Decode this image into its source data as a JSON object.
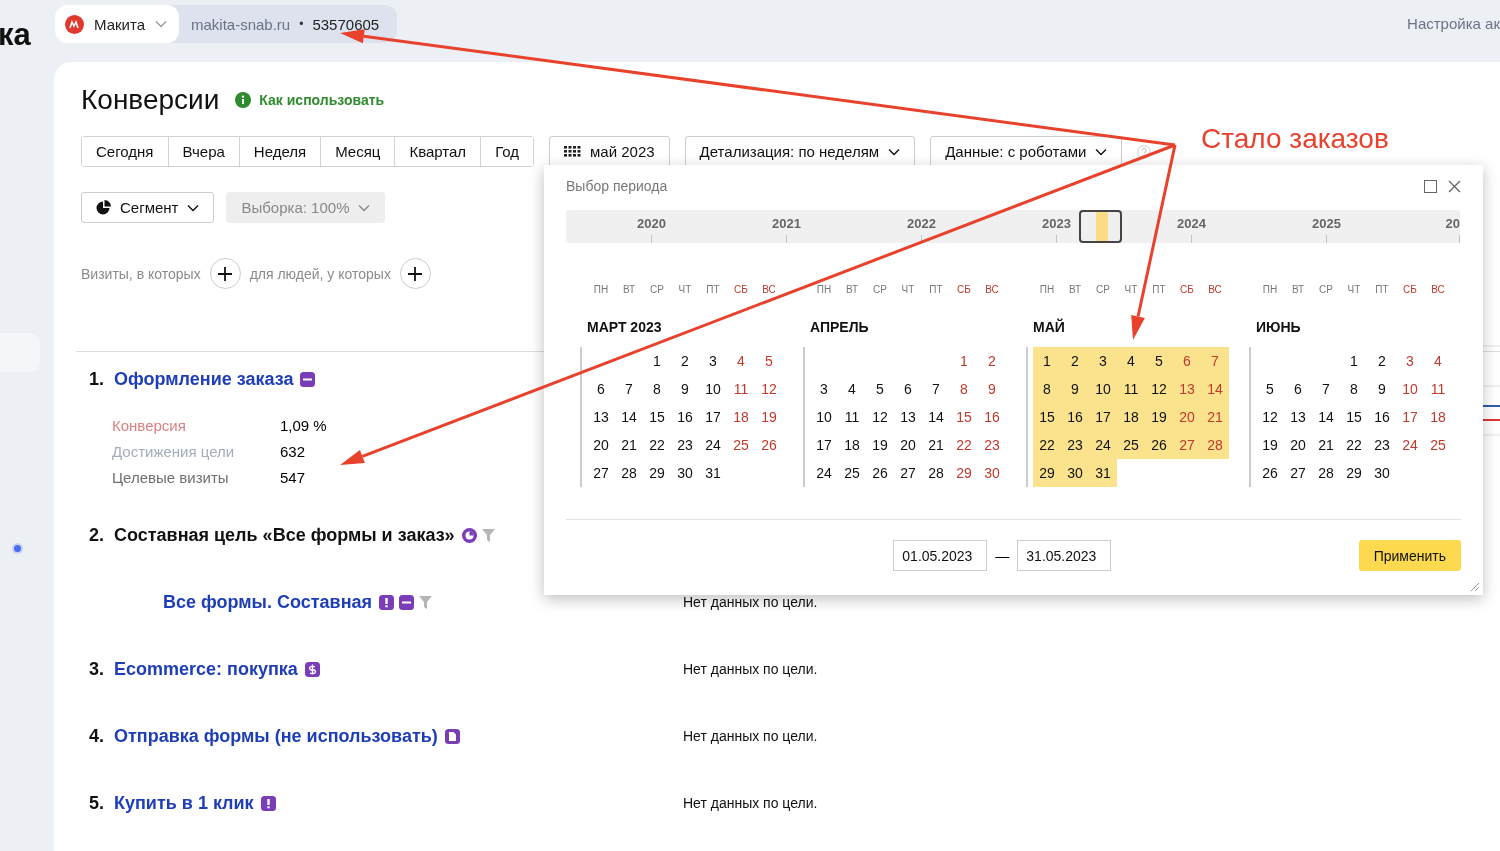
{
  "page_title_fragment": "ка",
  "account": {
    "name": "Макита",
    "site": "makita-snab.ru",
    "separator": "•",
    "counter": "53570605"
  },
  "top_right_link": "Настройка ак",
  "report": {
    "title": "Конверсии",
    "help_link": "Как использовать",
    "periods": [
      "Сегодня",
      "Вчера",
      "Неделя",
      "Месяц",
      "Квартал",
      "Год"
    ],
    "date_button": "май 2023",
    "detail_dropdown": "Детализация: по неделям",
    "data_dropdown": "Данные: с роботами",
    "segment_button": "Сегмент",
    "sample_dropdown": {
      "label": "Выборка: 100%",
      "disabled": true
    },
    "filter": {
      "visits_label": "Визиты, в которых",
      "people_label": "для людей, у которых"
    },
    "goals": [
      {
        "number": "1.",
        "name": "Оформление заказа",
        "kind": "link",
        "badges": [
          {
            "kind": "url"
          }
        ],
        "metrics": [
          {
            "label": "Конверсия",
            "value": "1,09 %",
            "color": "#d98080"
          },
          {
            "label": "Достижения цели",
            "value": "632",
            "color": "#a3acbd"
          },
          {
            "label": "Целевые визиты",
            "value": "547",
            "color": "#6f6f6f"
          }
        ]
      },
      {
        "number": "2.",
        "name": "Составная цель «Все формы и заказ»",
        "kind": "composite",
        "badges": [
          {
            "kind": "pie"
          },
          {
            "kind": "funnel"
          }
        ],
        "children": [
          {
            "name": "Все формы. Составная",
            "badges": [
              {
                "kind": "exclaim"
              },
              {
                "kind": "url"
              },
              {
                "kind": "funnel"
              }
            ],
            "note": "Нет данных по цели."
          }
        ]
      },
      {
        "number": "3.",
        "name": "Ecommerce: покупка",
        "kind": "link",
        "badges": [
          {
            "kind": "dollar"
          }
        ],
        "note": "Нет данных по цели."
      },
      {
        "number": "4.",
        "name": "Отправка формы (не использовать)",
        "kind": "link",
        "badges": [
          {
            "kind": "doc"
          }
        ],
        "note": "Нет данных по цели."
      },
      {
        "number": "5.",
        "name": "Купить в 1 клик",
        "kind": "link",
        "badges": [
          {
            "kind": "exclaim"
          }
        ],
        "note": "Нет данных по цели."
      }
    ]
  },
  "picker": {
    "title": "Выбор периода",
    "years": [
      "2020",
      "2021",
      "2022",
      "2023",
      "2024",
      "2025",
      "20"
    ],
    "months": [
      {
        "name": "МАРТ 2023",
        "selected": false,
        "weekdays": [
          "ПН",
          "ВТ",
          "СР",
          "ЧТ",
          "ПТ",
          "СБ",
          "ВС"
        ],
        "weeks": [
          [
            "1",
            "2",
            "3",
            "4",
            "5"
          ],
          [
            "6",
            "7",
            "8",
            "9",
            "10",
            "11",
            "12"
          ],
          [
            "13",
            "14",
            "15",
            "16",
            "17",
            "18",
            "19"
          ],
          [
            "20",
            "21",
            "22",
            "23",
            "24",
            "25",
            "26"
          ],
          [
            "27",
            "28",
            "29",
            "30",
            "31"
          ]
        ]
      },
      {
        "name": "АПРЕЛЬ",
        "selected": false,
        "weekdays": [
          "ПН",
          "ВТ",
          "СР",
          "ЧТ",
          "ПТ",
          "СБ",
          "ВС"
        ],
        "weeks": [
          [
            "1",
            "2"
          ],
          [
            "3",
            "4",
            "5",
            "6",
            "7",
            "8",
            "9"
          ],
          [
            "10",
            "11",
            "12",
            "13",
            "14",
            "15",
            "16"
          ],
          [
            "17",
            "18",
            "19",
            "20",
            "21",
            "22",
            "23"
          ],
          [
            "24",
            "25",
            "26",
            "27",
            "28",
            "29",
            "30"
          ]
        ]
      },
      {
        "name": "МАЙ",
        "selected": true,
        "weekdays": [
          "ПН",
          "ВТ",
          "СР",
          "ЧТ",
          "ПТ",
          "СБ",
          "ВС"
        ],
        "weeks": [
          [
            "1",
            "2",
            "3",
            "4",
            "5",
            "6",
            "7"
          ],
          [
            "8",
            "9",
            "10",
            "11",
            "12",
            "13",
            "14"
          ],
          [
            "15",
            "16",
            "17",
            "18",
            "19",
            "20",
            "21"
          ],
          [
            "22",
            "23",
            "24",
            "25",
            "26",
            "27",
            "28"
          ],
          [
            "29",
            "30",
            "31"
          ]
        ]
      },
      {
        "name": "ИЮНЬ",
        "selected": false,
        "weekdays": [
          "ПН",
          "ВТ",
          "СР",
          "ЧТ",
          "ПТ",
          "СБ",
          "ВС"
        ],
        "weeks": [
          [
            "1",
            "2",
            "3",
            "4"
          ],
          [
            "5",
            "6",
            "7",
            "8",
            "9",
            "10",
            "11"
          ],
          [
            "12",
            "13",
            "14",
            "15",
            "16",
            "17",
            "18"
          ],
          [
            "19",
            "20",
            "21",
            "22",
            "23",
            "24",
            "25"
          ],
          [
            "26",
            "27",
            "28",
            "29",
            "30"
          ]
        ]
      }
    ],
    "date_from": "01.05.2023",
    "date_separator": "—",
    "date_to": "31.05.2023",
    "apply_button": "Применить"
  },
  "annotation": {
    "text": "Стало заказов"
  }
}
